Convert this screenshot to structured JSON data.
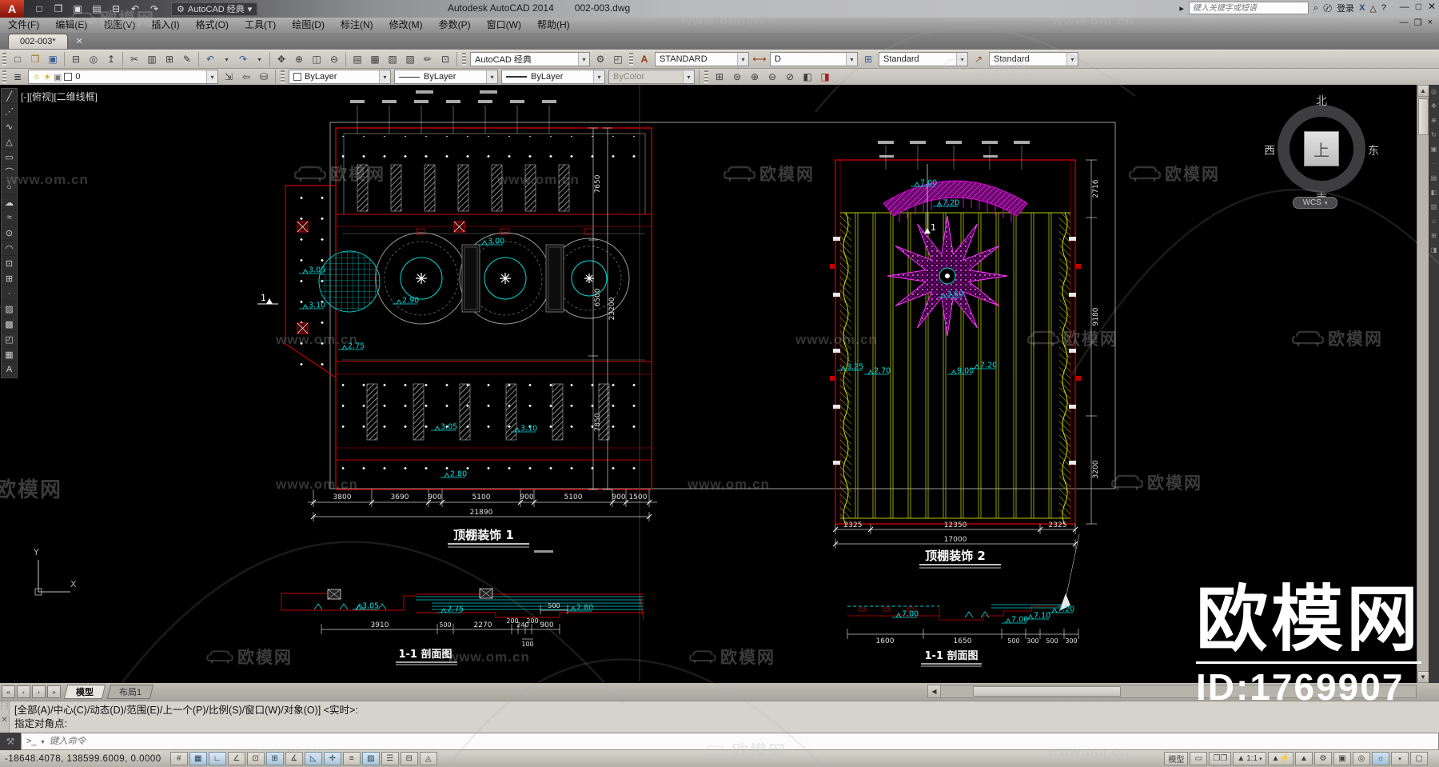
{
  "titlebar": {
    "app_title": "Autodesk AutoCAD 2014",
    "doc_title": "002-003.dwg",
    "workspace_label": "AutoCAD 经典",
    "search_placeholder": "键入关键字或短语",
    "signin": "登录"
  },
  "menubar": {
    "items": [
      "文件(F)",
      "编辑(E)",
      "视图(V)",
      "插入(I)",
      "格式(O)",
      "工具(T)",
      "绘图(D)",
      "标注(N)",
      "修改(M)",
      "参数(P)",
      "窗口(W)",
      "帮助(H)"
    ]
  },
  "filetab": {
    "name": "002-003*"
  },
  "toolbars": {
    "text_style": "STANDARD",
    "dim_style": "D",
    "table_style": "Standard",
    "mleader_style": "Standard"
  },
  "layers": {
    "layer_name": "0",
    "color": "ByLayer",
    "linetype": "ByLayer",
    "lineweight": "ByLayer",
    "plot_style": "ByColor"
  },
  "viewport": {
    "label": "[-][俯视][二维线框]",
    "compass": {
      "north": "北",
      "south": "南",
      "east": "东",
      "west": "西",
      "top": "上"
    },
    "wcs": "WCS",
    "ucs": {
      "x": "X",
      "y": "Y"
    }
  },
  "plan1": {
    "title": "顶棚装饰 1",
    "dims_bottom": [
      "3800",
      "3690",
      "900",
      "5100",
      "900",
      "5100",
      "900",
      "1500"
    ],
    "dim_total": "21890",
    "dims_right": [
      "7650",
      "6500",
      "7850"
    ],
    "dim_right_total": "23200",
    "elevations": [
      "3.05",
      "3.10",
      "2.75",
      "3.00",
      "2.90",
      "3.05",
      "3.10",
      "2.80"
    ],
    "marker": "1"
  },
  "section1": {
    "title": "1-1 剖面图",
    "dims": [
      "3910",
      "500",
      "2270",
      "200",
      "240",
      "200",
      "900"
    ],
    "dim_sub": "100",
    "dim_small": "500",
    "elevations": [
      "3.05",
      "2.75",
      "2.80"
    ]
  },
  "plan2": {
    "title": "顶棚装饰 2",
    "dims_bottom": [
      "2325",
      "12350",
      "2325"
    ],
    "dim_total": "17000",
    "dims_right": [
      "2716",
      "9180",
      "3200"
    ],
    "elevations": [
      "7.00",
      "7.20",
      "3.60",
      "3.25",
      "2.70",
      "9.00",
      "7.20"
    ],
    "marker": "1"
  },
  "section2": {
    "title": "1-1 剖面图",
    "dims": [
      "1600",
      "1650",
      "500",
      "300",
      "500",
      "300"
    ],
    "elevations": [
      "7.00",
      "7.00",
      "7.10",
      "7.20"
    ]
  },
  "model_tabs": {
    "model": "模型",
    "layout1": "布局1"
  },
  "command": {
    "line1": "[全部(A)/中心(C)/动态(D)/范围(E)/上一个(P)/比例(S)/窗口(W)/对象(O)] <实时>:",
    "line2": "指定对角点:",
    "input_placeholder": "键入命令"
  },
  "statusbar": {
    "coords": "-18648.4078, 138599.6009, 0.0000",
    "model_btn": "模型",
    "scale": "1:1"
  },
  "watermark": {
    "url": "www.om.cn",
    "brand": "欧模网",
    "id_label": "ID:1769907"
  },
  "colors": {
    "cad_red": "#c40000",
    "cad_cyan": "#00dcdc",
    "cad_magenta": "#e000e0",
    "cad_yellowgreen": "#b9c400"
  }
}
